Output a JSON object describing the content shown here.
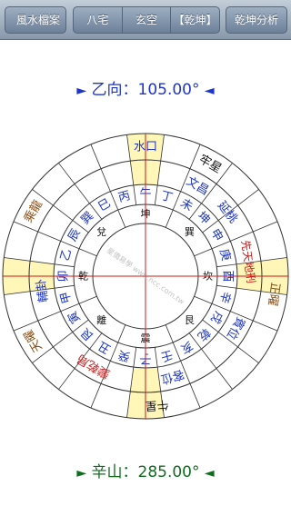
{
  "nav": {
    "back_label": "風水檔案",
    "tabs": [
      "八宅",
      "玄空",
      "【乾坤】"
    ],
    "right_label": "乾坤分析"
  },
  "top_direction": {
    "arrow_left": "►",
    "text": "乙向：105.00°",
    "arrow_right": "◄"
  },
  "bottom_direction": {
    "arrow_left": "►",
    "text": "辛山：285.00°",
    "arrow_right": "◄"
  },
  "colors": {
    "blue": "#1d35c8",
    "red": "#d01818",
    "brown": "#8b4c12",
    "black": "#111111",
    "grid": "#333333",
    "highlight": "#fff6b8",
    "center_text": "#999999"
  },
  "compass": {
    "outer_ring": {
      "南": "水口",
      "西北": "乘龍",
      "西": "先天地"
    },
    "sector_labels": [
      {
        "text": "水口",
        "color": "blue"
      },
      {
        "text": "文昌",
        "color": "blue"
      },
      {
        "text": "延桃",
        "color": "blue"
      },
      {
        "text": "先天地刑",
        "color": "red"
      },
      {
        "text": "乘龍",
        "color": "brown"
      },
      {
        "text": "輔卦",
        "color": "blue"
      },
      {
        "text": "變乾局",
        "color": "red"
      },
      {
        "text": "客位",
        "color": "blue"
      },
      {
        "text": "賓位",
        "color": "blue"
      },
      {
        "text": "牛星",
        "color": "black"
      },
      {
        "text": "牢星",
        "color": "black"
      },
      {
        "text": "正曜",
        "color": "brown"
      },
      {
        "text": "天曜",
        "color": "brown"
      }
    ],
    "mountains": [
      "午",
      "丁",
      "未",
      "坤",
      "申",
      "庚",
      "酉",
      "辛",
      "戌",
      "乾",
      "亥",
      "壬",
      "子",
      "癸",
      "丑",
      "艮",
      "寅",
      "甲",
      "卯",
      "乙",
      "辰",
      "巽",
      "巳",
      "丙"
    ],
    "trigrams": [
      "乾",
      "兌",
      "坤",
      "巽",
      "坎",
      "艮",
      "震",
      "離"
    ],
    "watermark": "星僑易學 www.ncc.com.tw"
  }
}
